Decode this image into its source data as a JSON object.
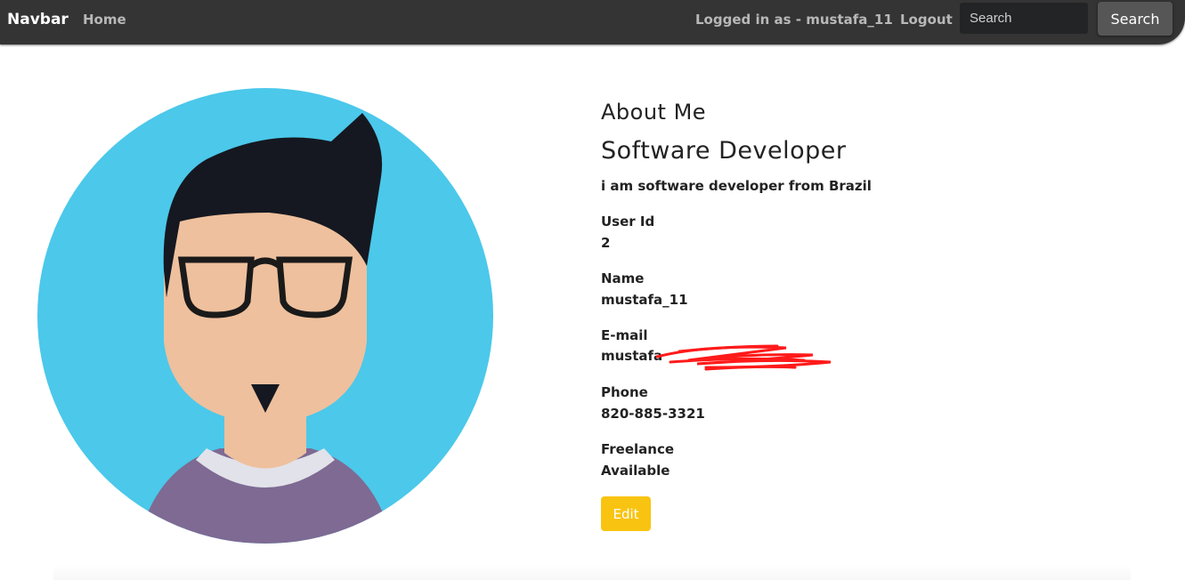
{
  "navbar": {
    "brand": "Navbar",
    "home_label": "Home",
    "logged_in_text": "Logged in as - mustafa_11",
    "logout_label": "Logout",
    "search_placeholder": "Search",
    "search_button_label": "Search",
    "background_color": "#343434"
  },
  "profile": {
    "avatar_icon": "man-with-glasses-avatar-icon",
    "about_heading": "About Me",
    "role": "Software Developer",
    "bio": "i am software developer from Brazil",
    "fields": {
      "user_id": {
        "label": "User Id",
        "value": "2"
      },
      "name": {
        "label": "Name",
        "value": "mustafa_11"
      },
      "email": {
        "label": "E-mail",
        "value": "mustafa"
      },
      "phone": {
        "label": "Phone",
        "value": "820-885-3321"
      },
      "freelance": {
        "label": "Freelance",
        "value": "Available"
      }
    },
    "edit_button_label": "Edit",
    "edit_button_color": "#f9c411"
  }
}
